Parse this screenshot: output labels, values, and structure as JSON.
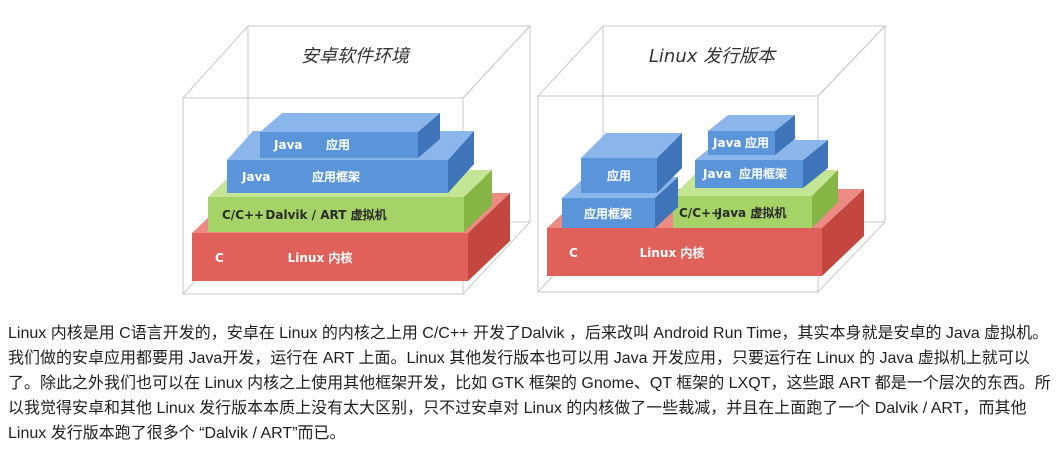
{
  "diagram": {
    "android": {
      "title": "安卓软件环境",
      "layers": {
        "app": {
          "left": "Java",
          "right": "应用"
        },
        "framework": {
          "left": "Java",
          "right": "应用框架"
        },
        "vm": {
          "left": "C/C++",
          "right": "Dalvik / ART 虚拟机"
        },
        "kernel": {
          "left": "C",
          "right": "Linux 内核"
        }
      }
    },
    "linux": {
      "title": "Linux 发行版本",
      "layers": {
        "app_left": "应用",
        "framework_left": "应用框架",
        "app_right": {
          "left": "Java",
          "right": "应用"
        },
        "framework_right": {
          "left": "Java",
          "right": "应用框架"
        },
        "vm_right": {
          "left": "C/C++",
          "right": "Java 虚拟机"
        },
        "kernel": {
          "left": "C",
          "right": "Linux 内核"
        }
      }
    },
    "colors": {
      "kernel_front": "#e0615a",
      "kernel_top": "#ec8a84",
      "kernel_side": "#c4473f",
      "vm_front": "#a6d367",
      "vm_top": "#c4e595",
      "vm_side": "#86b545",
      "blue_front": "#5b95d9",
      "blue_top": "#8ab6ec",
      "blue_side": "#3f75b8",
      "wire": "#c9c9c9"
    }
  },
  "article": {
    "text": "Linux 内核是用 C语言开发的，安卓在 Linux 的内核之上用 C/C++ 开发了Dalvik ，后来改叫 Android Run Time，其实本身就是安卓的 Java 虚拟机。我们做的安卓应用都要用 Java开发，运行在 ART 上面。Linux 其他发行版本也可以用 Java 开发应用，只要运行在 Linux 的 Java 虚拟机上就可以了。除此之外我们也可以在 Linux 内核之上使用其他框架开发，比如 GTK 框架的 Gnome、QT 框架的 LXQT，这些跟 ART 都是一个层次的东西。所以我觉得安卓和其他 Linux 发行版本本质上没有太大区别，只不过安卓对 Linux 的内核做了一些裁减，并且在上面跑了一个 Dalvik / ART，而其他 Linux 发行版本跑了很多个 “Dalvik / ART”而已。"
  }
}
